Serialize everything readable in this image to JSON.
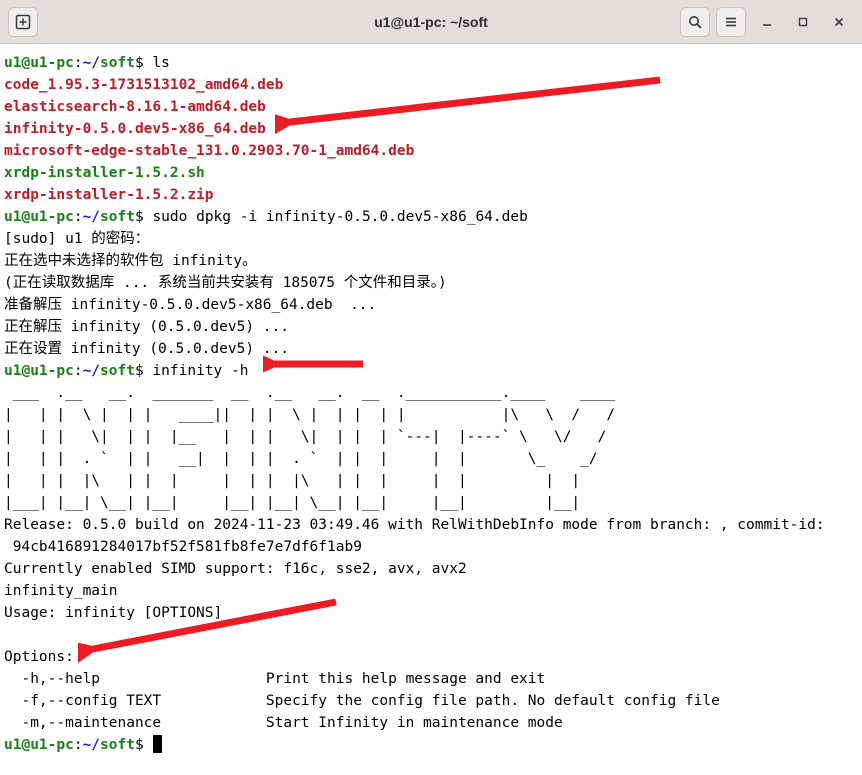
{
  "titlebar": {
    "title": "u1@u1-pc: ~/soft"
  },
  "prompt": {
    "user_host": "u1@u1-pc",
    "colon": ":",
    "path_prefix": "~/",
    "path_dir": "soft",
    "dollar": "$"
  },
  "commands": {
    "ls": "ls",
    "dpkg": "sudo dpkg -i infinity-0.5.0.dev5-x86_64.deb",
    "infinity": "infinity -h"
  },
  "files": {
    "f1": "code_1.95.3-1731513102_amd64.deb",
    "f2": "elasticsearch-8.16.1-amd64.deb",
    "f3": "infinity-0.5.0.dev5-x86_64.deb",
    "f4": "microsoft-edge-stable_131.0.2903.70-1_amd64.deb",
    "f5": "xrdp-installer-1.5.2.sh",
    "f6": "xrdp-installer-1.5.2.zip"
  },
  "dpkg_output": {
    "l1": "[sudo] u1 的密码：",
    "l2": "正在选中未选择的软件包 infinity。",
    "l3": "(正在读取数据库 ... 系统当前共安装有 185075 个文件和目录。)",
    "l4": "准备解压 infinity-0.5.0.dev5-x86_64.deb  ...",
    "l5": "正在解压 infinity (0.5.0.dev5) ...",
    "l6": "正在设置 infinity (0.5.0.dev5) ..."
  },
  "ascii": {
    "l1": " ___  .__   __.  _______  __  .__   __.  __  .___________.____    ____ ",
    "l2": "|   | |  \\ |  | |   ____||  | |  \\ |  | |  | |           |\\   \\  /   / ",
    "l3": "|   | |   \\|  | |  |__   |  | |   \\|  | |  | `---|  |----` \\   \\/   /  ",
    "l4": "|   | |  . `  | |   __|  |  | |  . `  | |  |     |  |       \\_    _/   ",
    "l5": "|   | |  |\\   | |  |     |  | |  |\\   | |  |     |  |         |  |     ",
    "l6": "|___| |__| \\__| |__|     |__| |__| \\__| |__|     |__|         |__|     "
  },
  "info": {
    "release": "Release: 0.5.0 build on 2024-11-23 03:49.46 with RelWithDebInfo mode from branch: , commit-id:",
    "commit": " 94cb416891284017bf52f581fb8fe7e7df6f1ab9",
    "simd": "Currently enabled SIMD support: f16c, sse2, avx, avx2",
    "main": "infinity_main",
    "usage": "Usage: infinity [OPTIONS]",
    "options_hdr": "Options:",
    "opt_h": "  -h,--help                   Print this help message and exit",
    "opt_f": "  -f,--config TEXT            Specify the config file path. No default config file",
    "opt_m": "  -m,--maintenance            Start Infinity in maintenance mode"
  }
}
